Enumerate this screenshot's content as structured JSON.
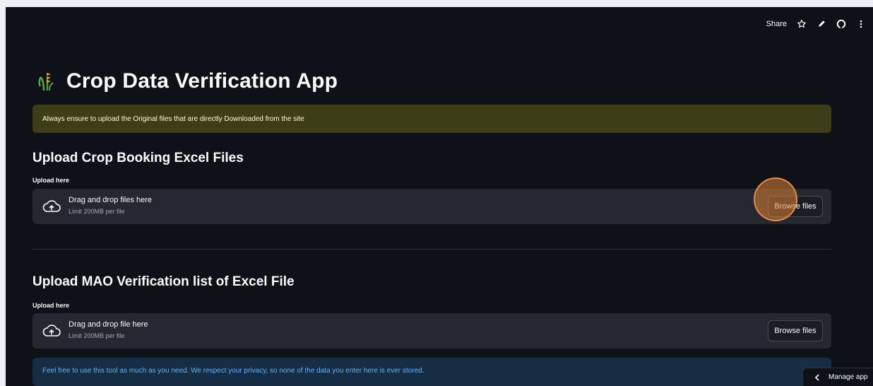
{
  "toolbar": {
    "share_label": "Share",
    "icons": [
      "star-icon",
      "pencil-icon",
      "github-icon",
      "more-vertical-icon"
    ]
  },
  "header": {
    "title": "Crop Data Verification App",
    "icon": "crop-icon"
  },
  "warning": {
    "text": "Always ensure to upload the Original files that are directly Downloaded from the site"
  },
  "sections": [
    {
      "title": "Upload Crop Booking Excel Files",
      "upload_label": "Upload here",
      "drop_text": "Drag and drop files here",
      "limit_text": "Limit 200MB per file",
      "button_label": "Browse files"
    },
    {
      "title": "Upload MAO Verification list of Excel File",
      "upload_label": "Upload here",
      "drop_text": "Drag and drop file here",
      "limit_text": "Limit 200MB per file",
      "button_label": "Browse files"
    }
  ],
  "info": {
    "text": "Feel free to use this tool as much as you need. We respect your privacy, so none of the data you enter here is ever stored."
  },
  "manage_app": {
    "label": "Manage app"
  },
  "colors": {
    "background": "#0e1117",
    "warning_bg": "#3d3d18",
    "info_bg": "#172d43",
    "cursor_highlight": "#dd8438"
  }
}
